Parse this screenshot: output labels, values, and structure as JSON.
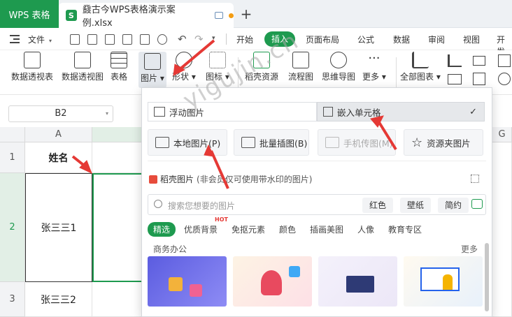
{
  "titlebar": {
    "app_name": "WPS 表格",
    "file_logo": "S",
    "file_name": "鼗古今WPS表格演示案例.xlsx",
    "new_tab": "+"
  },
  "menu": {
    "file_label": "文件",
    "tabs": [
      "开始",
      "插入",
      "页面布局",
      "公式",
      "数据",
      "审阅",
      "视图",
      "开发"
    ]
  },
  "ribbon": {
    "items": [
      "数据透视表",
      "数据透视图",
      "表格",
      "图片",
      "形状",
      "图标",
      "稻壳资源",
      "流程图",
      "思维导图",
      "更多",
      "全部图表"
    ]
  },
  "namebox": {
    "value": "B2"
  },
  "grid": {
    "col_a": "A",
    "col_g": "G",
    "rows": [
      "1",
      "2",
      "3"
    ],
    "cells": [
      "姓名",
      "张三三1",
      "张三三2"
    ]
  },
  "panel": {
    "float_image": "浮动图片",
    "embed_cell": "嵌入单元格",
    "local_image": "本地图片(P)",
    "batch_insert": "批量插图(B)",
    "phone_image": "手机传图(M)",
    "folder_image": "资源夹图片",
    "docer_title": "稻壳图片",
    "docer_note": "(非会员仅可使用带水印的图片)",
    "search_placeholder": "搜索您想要的图片",
    "search_tags": [
      "红色",
      "壁纸",
      "简约"
    ],
    "categories": [
      "精选",
      "优质背景",
      "免抠元素",
      "颜色",
      "插画美图",
      "人像",
      "教育专区"
    ],
    "hot_badge": "HOT",
    "section_title": "商务办公",
    "more_link": "更多"
  },
  "watermark": "yigujin.cn",
  "colors": {
    "accent": "#1e9a4f",
    "arrow": "#e53935"
  }
}
